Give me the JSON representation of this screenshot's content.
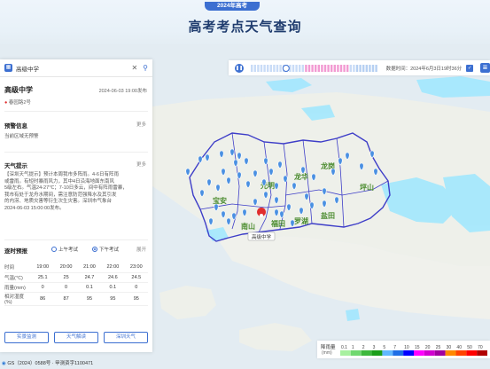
{
  "header": {
    "badge": "2024年高考",
    "title": "高考考点天气查询"
  },
  "search": {
    "query": "高级中学"
  },
  "location": {
    "name": "高级中学",
    "time": "2024-06-03 19:00发布",
    "address": "春园路2号"
  },
  "alert": {
    "title": "预警信息",
    "more": "更多",
    "text": "当前区域无预警"
  },
  "tips": {
    "title": "天气提示",
    "more": "更多",
    "lines": [
      "【深圳天气提示】预计本周我市多阵雨。4-6日有阵雨",
      "或雷雨。有短时暴雨风力，其中4日沿海地面东南风",
      "5级左右。气温24-27℃；7-10日多云，间中有阵雨雷暴，",
      "我市有处于龙舟水期间，需注意防范强降水及其引发",
      "的内涝、地质灾害等衍生次生灾害。深圳市气象台",
      "2024-06-03 15:00:00发布。"
    ]
  },
  "forecast": {
    "title": "逐时预报",
    "toggle_a": "上午考试",
    "toggle_b": "下午考试",
    "expand": "展开",
    "times": [
      "19:00",
      "20:00",
      "21:00",
      "22:00",
      "23:00"
    ],
    "rows": [
      {
        "label": "时间",
        "values": [
          "19:00",
          "20:00",
          "21:00",
          "22:00",
          "23:00"
        ]
      },
      {
        "label": "气温(℃)",
        "values": [
          "25.1",
          "25",
          "24.7",
          "24.6",
          "24.5"
        ]
      },
      {
        "label": "雨量(mm)",
        "values": [
          "0",
          "0",
          "0.1",
          "0.1",
          "0"
        ]
      },
      {
        "label": "相对湿度(%)",
        "values": [
          "86",
          "87",
          "95",
          "95",
          "95"
        ]
      }
    ]
  },
  "buttons": {
    "live": "实景监测",
    "interpret": "天气解读",
    "shenzhen": "深圳天气"
  },
  "timeline": {
    "label": "数据时间：2024年6月3日19时36分",
    "progress": 0.27
  },
  "map": {
    "districts": [
      "宝安",
      "光明",
      "龙华",
      "龙岗",
      "坪山",
      "南山",
      "福田",
      "罗湖",
      "盐田"
    ],
    "marker_label": "高级中学"
  },
  "legend": {
    "title": "降雨量",
    "unit": "(mm)",
    "ticks": [
      "0.1",
      "1",
      "2",
      "3",
      "5",
      "7",
      "10",
      "15",
      "20",
      "25",
      "30",
      "40",
      "50",
      "70"
    ],
    "colors": [
      "#a8f0a0",
      "#70d870",
      "#3db83d",
      "#1a9e1a",
      "#61b8ff",
      "#1e6ee6",
      "#0000ff",
      "#ff00ff",
      "#d000d0",
      "#a000a0",
      "#ff8800",
      "#ff4400",
      "#ff0000",
      "#b00000"
    ]
  },
  "footer": {
    "text": "GS（2024）0588号 · 甲测资字1100471"
  },
  "colors": {
    "accent": "#3c6fd1",
    "boundary": "#3e3ec8",
    "pin": "#4a90e2",
    "rain": "#9ee7ff"
  }
}
